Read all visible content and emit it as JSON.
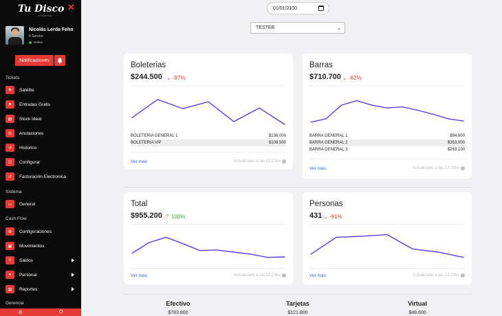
{
  "sidebar": {
    "logo_text": "Tu Disco",
    "logo_sub": "TICKETING",
    "close_glyph": "✕",
    "user": {
      "name": "Nicolás Lerda Fehn",
      "role": "It Service",
      "status": "Online"
    },
    "notifications_label": "Notificaciones",
    "sections": [
      {
        "title": "Tickets",
        "items": [
          {
            "label": "Satélite",
            "icon": "flag-icon"
          },
          {
            "label": "Entradas Gratis",
            "icon": "flag-icon"
          },
          {
            "label": "Stock Ideal",
            "icon": "box-icon"
          },
          {
            "label": "Anulaciones",
            "icon": "ban-icon"
          },
          {
            "label": "Historico",
            "icon": "history-icon"
          },
          {
            "label": "Configurar",
            "icon": "settings-icon"
          },
          {
            "label": "Facturación Electronica",
            "icon": "history-icon"
          }
        ]
      },
      {
        "title": "Sistema",
        "items": [
          {
            "label": "General",
            "icon": "monitor-icon"
          }
        ]
      },
      {
        "title": "Cash Flow",
        "items": [
          {
            "label": "Configuraciones",
            "icon": "gear-icon"
          },
          {
            "label": "Movimientos",
            "icon": "briefcase-icon"
          },
          {
            "label": "Saldos",
            "icon": "list-icon",
            "submenu": true
          },
          {
            "label": "Personal",
            "icon": "user-icon",
            "submenu": true
          },
          {
            "label": "Reportes",
            "icon": "chart-icon",
            "submenu": true
          }
        ]
      },
      {
        "title": "Gerencia",
        "items": []
      }
    ]
  },
  "filters": {
    "date_value": "01/01/2100",
    "select_value": "TESTER"
  },
  "cards": [
    {
      "id": "boleterias",
      "title": "Boleterias",
      "value": "$244.500",
      "change": "-97%",
      "trend": "down",
      "rows": [
        {
          "name": "BOLETERIA GENERAL 1",
          "amount": "$136.000"
        },
        {
          "name": "BOLETERIA VIP",
          "amount": "$108.500"
        }
      ],
      "link": "Ver más",
      "updated": "Actualizado a las 12:23hs"
    },
    {
      "id": "barras",
      "title": "Barras",
      "value": "$710.700",
      "change": "-62%",
      "trend": "down",
      "rows": [
        {
          "name": "BARRA GENERAL 1",
          "amount": "$94.600"
        },
        {
          "name": "BARRA GENERAL 2",
          "amount": "$353.000"
        },
        {
          "name": "BARRA GENERAL 3",
          "amount": "$263.100"
        }
      ],
      "link": "Ver más",
      "updated": "Actualizado a las 12:23hs"
    },
    {
      "id": "total",
      "title": "Total",
      "value": "$955.200",
      "change": "100%",
      "trend": "up",
      "rows": [],
      "link": "Ver más",
      "updated": "Actualizado a las 12:23hs"
    },
    {
      "id": "personas",
      "title": "Personas",
      "value": "431",
      "change": "-91%",
      "trend": "down",
      "rows": [],
      "link": "Ver más",
      "updated": "Actualizado a las 12:23hs"
    }
  ],
  "chart_data": [
    {
      "type": "line",
      "series": [
        {
          "values": [
            30,
            62,
            46,
            58,
            23,
            47,
            18
          ]
        }
      ],
      "ylim": [
        0,
        80
      ],
      "color": "#5b3be8"
    },
    {
      "type": "line",
      "series": [
        {
          "values": [
            22,
            28,
            52,
            60,
            52,
            47,
            49,
            43,
            36,
            28,
            24
          ]
        }
      ],
      "ylim": [
        0,
        80
      ],
      "color": "#5b3be8"
    },
    {
      "type": "line",
      "series": [
        {
          "values": [
            20,
            40,
            50,
            38,
            25,
            26,
            22,
            18,
            12,
            13
          ]
        }
      ],
      "ylim": [
        0,
        70
      ],
      "color": "#5b3be8"
    },
    {
      "type": "line",
      "series": [
        {
          "values": [
            18,
            50,
            52,
            55,
            28,
            22,
            12
          ]
        }
      ],
      "ylim": [
        0,
        70
      ],
      "color": "#5b3be8"
    }
  ],
  "totals": [
    {
      "label": "Efectivo",
      "value": "$783.800"
    },
    {
      "label": "Tarjetas",
      "value": "$121.800"
    },
    {
      "label": "Virtual",
      "value": "$49.600"
    }
  ],
  "colors": {
    "accent": "#e53935",
    "line": "#5b3be8",
    "link": "#3b5bdb",
    "positive": "#43a047"
  }
}
